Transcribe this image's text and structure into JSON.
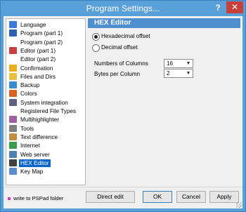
{
  "window": {
    "title": "Program Settings...",
    "help_label": "?",
    "close_label": "✕"
  },
  "sidebar": {
    "items": [
      {
        "label": "Language",
        "icon": "flag-icon",
        "color": "#3b7ad8"
      },
      {
        "label": "Program  (part 1)",
        "icon": "program-icon",
        "color": "#2f5fb0"
      },
      {
        "label": "Program  (part 2)",
        "icon": "",
        "color": ""
      },
      {
        "label": "Editor  (part 1)",
        "icon": "editor-icon",
        "color": "#c84040"
      },
      {
        "label": "Editor  (part 2)",
        "icon": "",
        "color": ""
      },
      {
        "label": "Confirmation",
        "icon": "confirmation-icon",
        "color": "#e8b020"
      },
      {
        "label": "Files and Dirs",
        "icon": "folder-icon",
        "color": "#e8c040"
      },
      {
        "label": "Backup",
        "icon": "backup-icon",
        "color": "#3a8ad0"
      },
      {
        "label": "Colors",
        "icon": "palette-icon",
        "color": "#d86020"
      },
      {
        "label": "System integration",
        "icon": "system-icon",
        "color": "#606080"
      },
      {
        "label": "Registered File Types",
        "icon": "",
        "color": ""
      },
      {
        "label": "Multihighlighter",
        "icon": "highlighter-icon",
        "color": "#a060a0"
      },
      {
        "label": "Tools",
        "icon": "tools-icon",
        "color": "#808080"
      },
      {
        "label": "Text difference",
        "icon": "text-diff-icon",
        "color": "#c09040"
      },
      {
        "label": "Internet",
        "icon": "globe-icon",
        "color": "#3a9a50"
      },
      {
        "label": "Web server",
        "icon": "web-server-icon",
        "color": "#5080b0"
      },
      {
        "label": "HEX Editor",
        "icon": "hex-editor-icon",
        "color": "#404040",
        "selected": true
      },
      {
        "label": "Key Map",
        "icon": "key-map-icon",
        "color": "#5a8ad0"
      }
    ]
  },
  "page": {
    "title": "HEX Editor",
    "radio_hex": "Hexadecimal offset",
    "radio_dec": "Decimal offset",
    "columns_label": "Numbers of Columns",
    "columns_value": "16",
    "bytes_label": "Bytes per Column",
    "bytes_value": "2",
    "header_color": "#4f8fcf"
  },
  "footer": {
    "folder_label": "write to PSPad folder",
    "direct_edit": "Direct edit",
    "ok": "OK",
    "cancel": "Cancel",
    "apply": "Apply"
  }
}
